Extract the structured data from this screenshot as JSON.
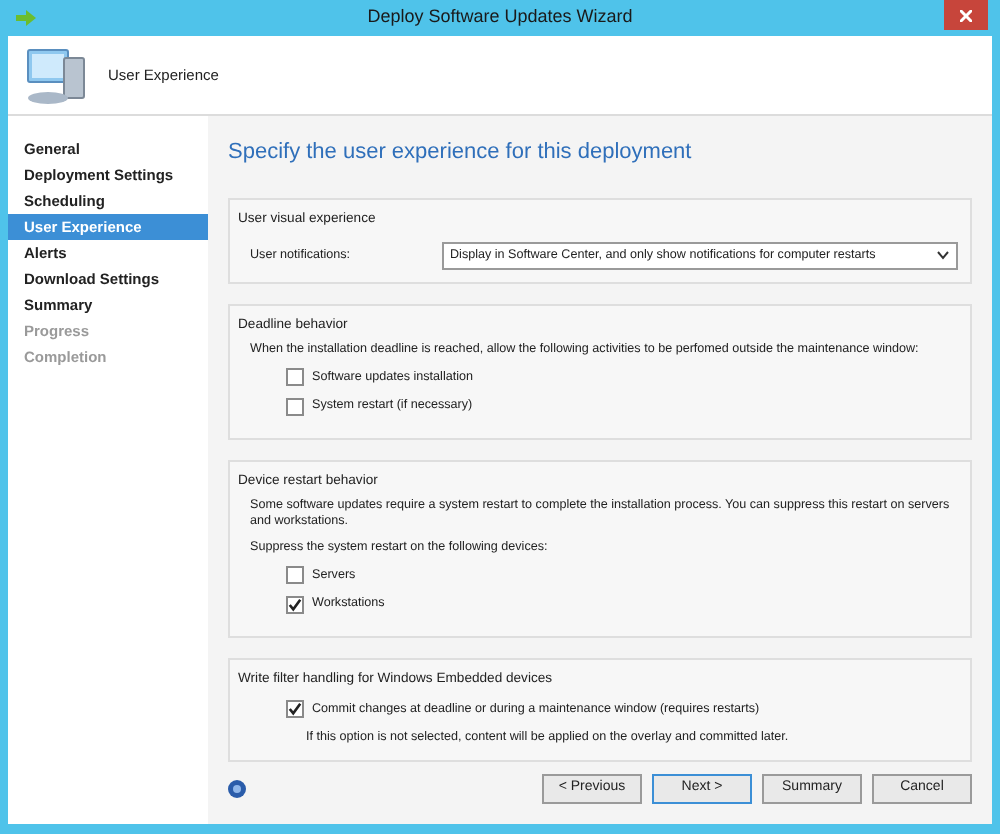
{
  "window": {
    "title": "Deploy Software Updates Wizard"
  },
  "header": {
    "title": "User Experience"
  },
  "sidebar": {
    "items": [
      {
        "label": "General",
        "selected": false,
        "disabled": false
      },
      {
        "label": "Deployment Settings",
        "selected": false,
        "disabled": false
      },
      {
        "label": "Scheduling",
        "selected": false,
        "disabled": false
      },
      {
        "label": "User Experience",
        "selected": true,
        "disabled": false
      },
      {
        "label": "Alerts",
        "selected": false,
        "disabled": false
      },
      {
        "label": "Download Settings",
        "selected": false,
        "disabled": false
      },
      {
        "label": "Summary",
        "selected": false,
        "disabled": false
      },
      {
        "label": "Progress",
        "selected": false,
        "disabled": true
      },
      {
        "label": "Completion",
        "selected": false,
        "disabled": true
      }
    ]
  },
  "page_heading": "Specify the user experience for this deployment",
  "groups": [
    {
      "title": "User visual experience",
      "items": [
        {
          "kind": "select",
          "label": "User notifications:",
          "value": "Display in Software Center, and only show notifications for computer restarts"
        }
      ]
    },
    {
      "title": "Deadline behavior",
      "items": [
        {
          "kind": "text",
          "text": "When the installation deadline is reached, allow the following activities to be perfomed outside the maintenance window:"
        },
        {
          "kind": "checkbox",
          "label": "Software updates installation",
          "checked": false
        },
        {
          "kind": "checkbox",
          "label": "System restart (if necessary)",
          "checked": false
        }
      ]
    },
    {
      "title": "Device restart behavior",
      "items": [
        {
          "kind": "text",
          "text": "Some software updates require a system restart to complete the installation process. You can suppress this restart on servers and workstations."
        },
        {
          "kind": "text",
          "text": "Suppress the system restart on the following devices:"
        },
        {
          "kind": "checkbox",
          "label": "Servers",
          "checked": false
        },
        {
          "kind": "checkbox",
          "label": "Workstations",
          "checked": true
        }
      ]
    },
    {
      "title": "Write filter handling for Windows Embedded devices",
      "items": [
        {
          "kind": "checkbox",
          "label": "Commit changes at deadline or during a maintenance window (requires restarts)",
          "checked": true
        },
        {
          "kind": "note",
          "text": "If this option is not selected, content will be applied on the overlay and committed later."
        }
      ]
    }
  ],
  "buttons": [
    {
      "label": "< Previous",
      "selected": false
    },
    {
      "label": "Next >",
      "selected": true
    },
    {
      "label": "Summary",
      "selected": false
    },
    {
      "label": "Cancel",
      "selected": false
    }
  ]
}
